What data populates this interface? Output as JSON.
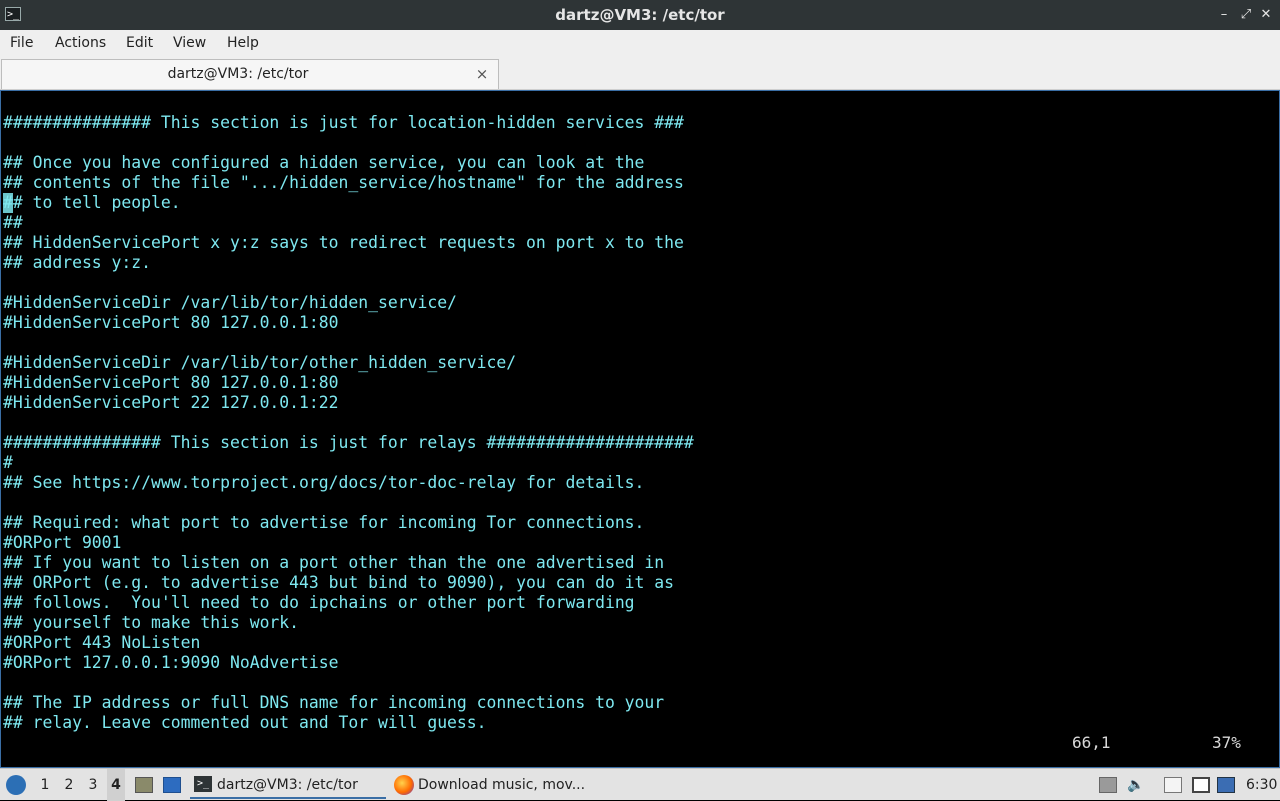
{
  "window": {
    "title": "dartz@VM3: /etc/tor",
    "app_icon_glyph": ">_",
    "controls": {
      "minimize": "–",
      "maximize": "⤢",
      "close": "✕"
    }
  },
  "menu": [
    {
      "label": "File"
    },
    {
      "label": "Actions"
    },
    {
      "label": "Edit"
    },
    {
      "label": "View"
    },
    {
      "label": "Help"
    }
  ],
  "tab": {
    "label": "dartz@VM3: /etc/tor",
    "close_glyph": "×"
  },
  "terminal": {
    "lines": [
      "############### This section is just for location-hidden services ###",
      "",
      "## Once you have configured a hidden service, you can look at the",
      "## contents of the file \".../hidden_service/hostname\" for the address",
      "## to tell people.",
      "##",
      "## HiddenServicePort x y:z says to redirect requests on port x to the",
      "## address y:z.",
      "",
      "#HiddenServiceDir /var/lib/tor/hidden_service/",
      "#HiddenServicePort 80 127.0.0.1:80",
      "",
      "#HiddenServiceDir /var/lib/tor/other_hidden_service/",
      "#HiddenServicePort 80 127.0.0.1:80",
      "#HiddenServicePort 22 127.0.0.1:22",
      "",
      "################ This section is just for relays #####################",
      "#",
      "## See https://www.torproject.org/docs/tor-doc-relay for details.",
      "",
      "## Required: what port to advertise for incoming Tor connections.",
      "#ORPort 9001",
      "## If you want to listen on a port other than the one advertised in",
      "## ORPort (e.g. to advertise 443 but bind to 9090), you can do it as",
      "## follows.  You'll need to do ipchains or other port forwarding",
      "## yourself to make this work.",
      "#ORPort 443 NoListen",
      "#ORPort 127.0.0.1:9090 NoAdvertise",
      "",
      "## The IP address or full DNS name for incoming connections to your",
      "## relay. Leave commented out and Tor will guess."
    ],
    "cursor_position": "66,1",
    "scroll_percent": "37%",
    "text_color": "#7ee8f0"
  },
  "taskbar": {
    "workspaces": [
      "1",
      "2",
      "3",
      "4"
    ],
    "active_workspace": "4",
    "tasks": [
      {
        "label": "dartz@VM3: /etc/tor",
        "icon": "terminal-icon"
      },
      {
        "label": "Download music, mov...",
        "icon": "firefox-icon"
      }
    ],
    "tray_icons": [
      "disk-icon",
      "volume-icon",
      "clipboard-icon",
      "network-icon",
      "update-icon"
    ],
    "clock": "6:30"
  }
}
